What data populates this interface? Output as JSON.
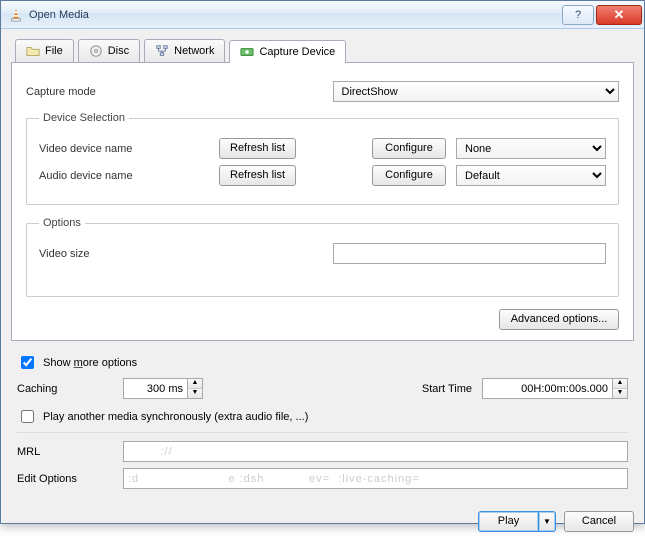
{
  "window": {
    "title": "Open Media"
  },
  "tabs": {
    "file": "File",
    "disc": "Disc",
    "network": "Network",
    "capture": "Capture Device"
  },
  "capture": {
    "mode_label": "Capture mode",
    "mode_value": "DirectShow",
    "device_selection_label": "Device Selection",
    "video_label": "Video device name",
    "audio_label": "Audio device name",
    "refresh_label": "Refresh list",
    "configure_label": "Configure",
    "video_value": "None",
    "audio_value": "Default",
    "options_label": "Options",
    "video_size_label": "Video size",
    "video_size_value": "",
    "advanced_label": "Advanced options..."
  },
  "more": {
    "show_label_pre": "Show ",
    "show_label_underlined": "m",
    "show_label_post": "ore options",
    "show_checked": true,
    "caching_label": "Caching",
    "caching_value": "300 ms",
    "start_label": "Start Time",
    "start_value": "00H:00m:00s.000",
    "sync_label": "Play another media synchronously (extra audio file, ...)",
    "mrl_label": "MRL",
    "mrl_value": "        ://",
    "edit_label": "Edit Options",
    "edit_value": ":d                      e :dsh           ev=  :live-caching="
  },
  "footer": {
    "play_label": "Play",
    "cancel_label": "Cancel"
  }
}
